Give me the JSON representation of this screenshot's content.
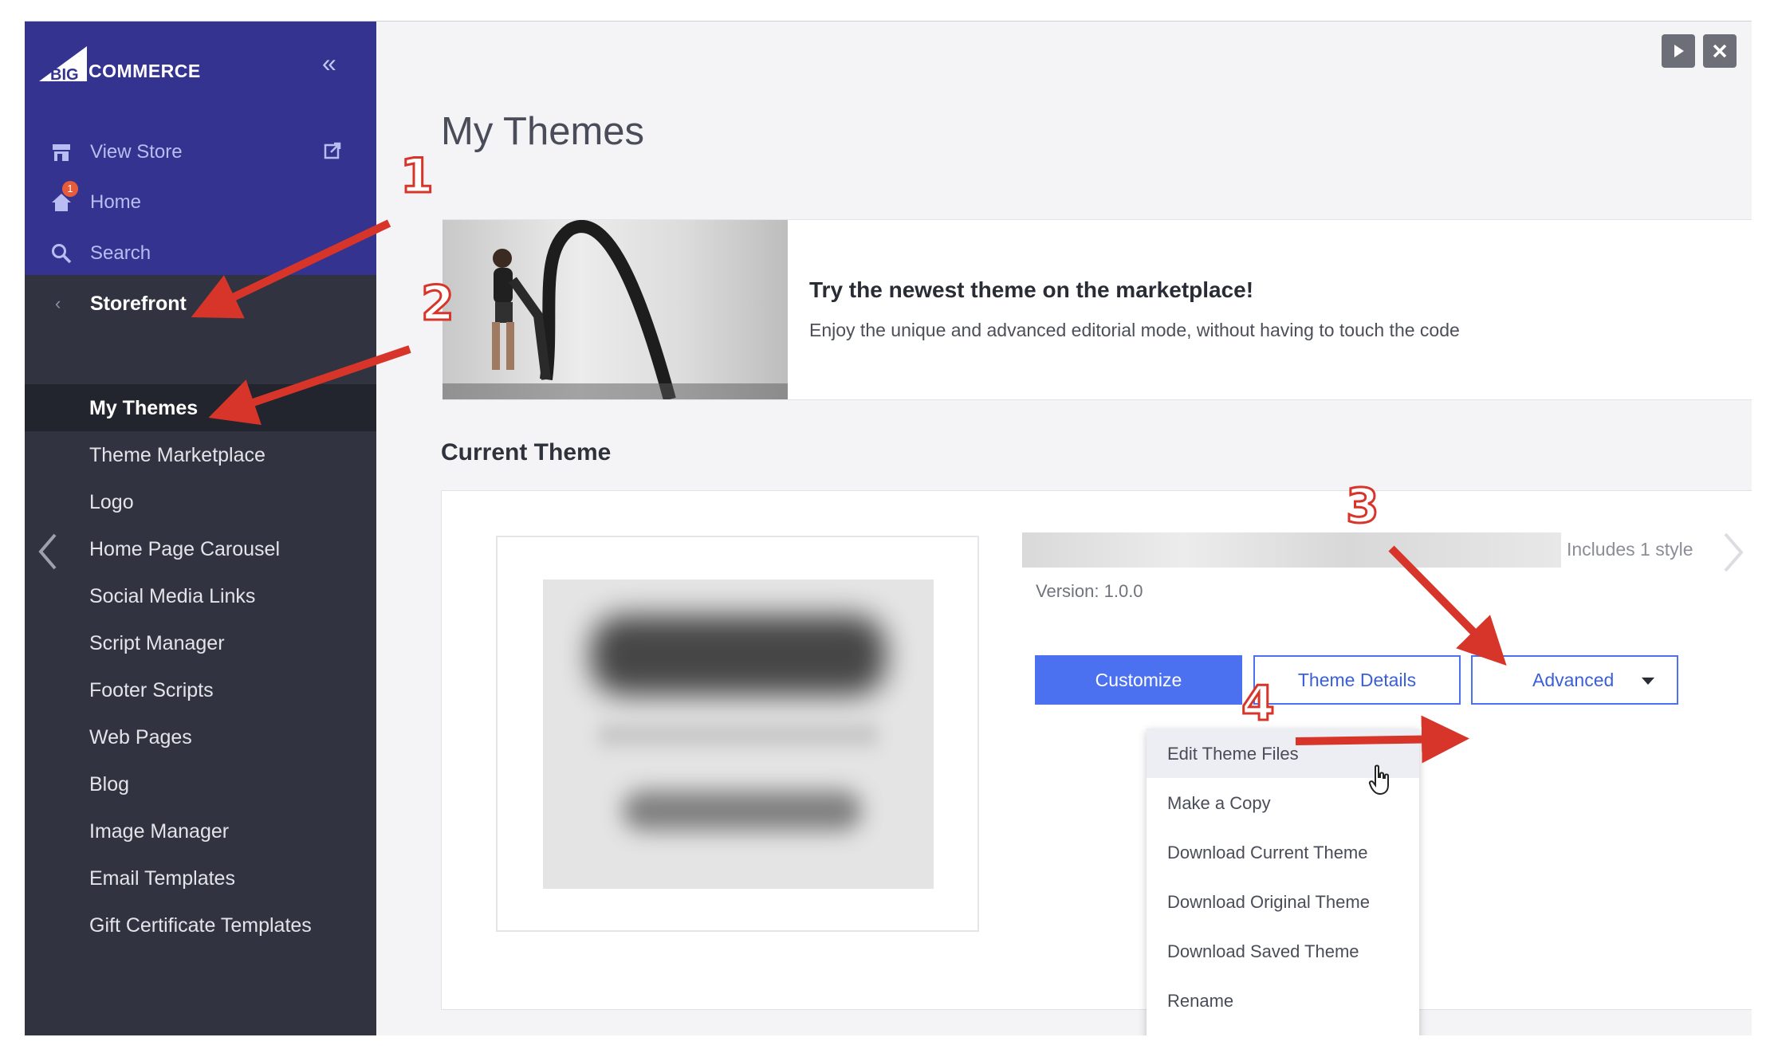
{
  "brand": {
    "logo_mark": "BIG",
    "logo_word": "COMMERCE"
  },
  "sidebar": {
    "collapse_glyph": "«",
    "top_items": [
      {
        "label": "View Store",
        "icon": "store-icon"
      },
      {
        "label": "Home",
        "icon": "home-icon",
        "badge": "1"
      },
      {
        "label": "Search",
        "icon": "search-icon"
      }
    ],
    "section": {
      "label": "Storefront",
      "chevron": "‹"
    },
    "items": [
      {
        "label": "My Themes",
        "active": true
      },
      {
        "label": "Theme Marketplace"
      },
      {
        "label": "Logo"
      },
      {
        "label": "Home Page Carousel"
      },
      {
        "label": "Social Media Links"
      },
      {
        "label": "Script Manager"
      },
      {
        "label": "Footer Scripts"
      },
      {
        "label": "Web Pages"
      },
      {
        "label": "Blog"
      },
      {
        "label": "Image Manager"
      },
      {
        "label": "Email Templates"
      },
      {
        "label": "Gift Certificate Templates"
      }
    ]
  },
  "main": {
    "title": "My Themes",
    "banner": {
      "title": "Try the newest theme on the marketplace!",
      "subtitle": "Enjoy the unique and advanced editorial mode, without having to touch the code"
    },
    "current_theme": {
      "section_title": "Current Theme",
      "includes": "Includes 1 style",
      "version": "Version: 1.0.0",
      "buttons": {
        "customize": "Customize",
        "details": "Theme Details",
        "advanced": "Advanced"
      }
    },
    "advanced_menu": [
      "Edit Theme Files",
      "Make a Copy",
      "Download Current Theme",
      "Download Original Theme",
      "Download Saved Theme",
      "Rename"
    ]
  },
  "annotations": [
    "1",
    "2",
    "3",
    "4"
  ],
  "colors": {
    "sidebar_top": "#34338f",
    "sidebar": "#313440",
    "accent": "#4b71f0",
    "annotation": "#d8352a"
  }
}
